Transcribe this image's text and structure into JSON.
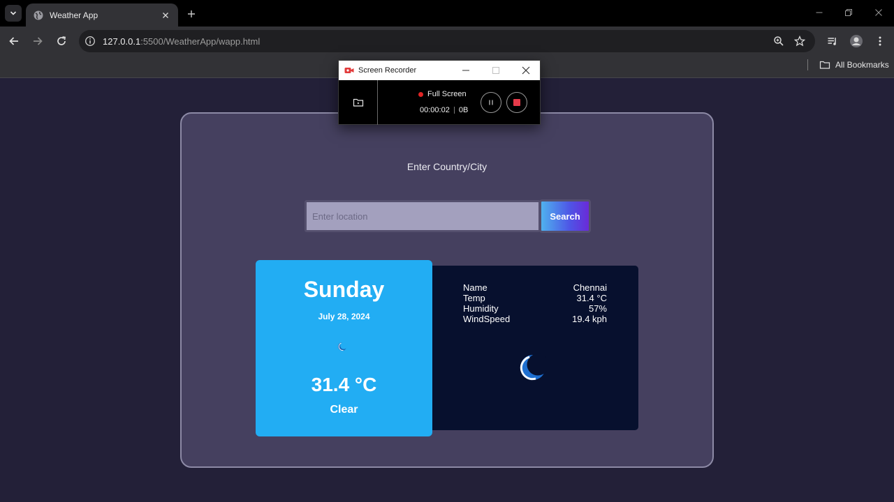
{
  "browser": {
    "tab_title": "Weather App",
    "url_host": "127.0.0.1",
    "url_path": ":5500/WeatherApp/wapp.html",
    "bookmarks_label": "All Bookmarks"
  },
  "recorder": {
    "title": "Screen Recorder",
    "mode": "Full Screen",
    "elapsed": "00:00:02",
    "size": "0B",
    "accent": "#e02424"
  },
  "app": {
    "heading": "Enter Country/City",
    "search": {
      "placeholder": "Enter location",
      "button_label": "Search"
    },
    "day_card": {
      "day": "Sunday",
      "date": "July 28, 2024",
      "temp": "31.4 °C",
      "condition": "Clear",
      "icon": "moon-icon",
      "color": "#22adf3"
    },
    "details": {
      "rows": [
        {
          "label": "Name",
          "value": "Chennai"
        },
        {
          "label": "Temp",
          "value": "31.4 °C"
        },
        {
          "label": "Humidity",
          "value": "57%"
        },
        {
          "label": "WindSpeed",
          "value": "19.4 kph"
        }
      ],
      "icon": "moon-icon",
      "color": "#07102e"
    }
  }
}
